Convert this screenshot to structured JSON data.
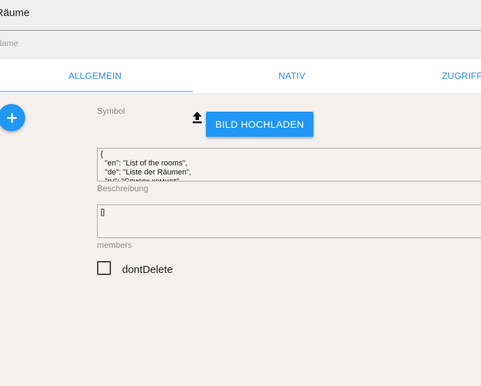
{
  "title_field": {
    "value": "Räume"
  },
  "name_field": {
    "label": "Name"
  },
  "tabs": [
    {
      "label": "ALLGEMEIN",
      "active": true
    },
    {
      "label": "NATIV",
      "active": false
    },
    {
      "label": "ZUGRIFFSRECHTE",
      "active": false
    }
  ],
  "fab": {
    "icon": "plus-icon"
  },
  "symbol": {
    "label": "Symbol",
    "upload_icon": "upload-icon",
    "upload_button": "BILD HOCHLADEN"
  },
  "description": {
    "value": "{\n  \"en\": \"List of the rooms\",\n  \"de\": \"Liste der Räumen\",\n  \"ru\": \"Список комнат\"",
    "label": "Beschreibung"
  },
  "members": {
    "value": "[]",
    "label": "members"
  },
  "dont_delete": {
    "label": "dontDelete",
    "checked": false
  },
  "colors": {
    "accent": "#2196f3",
    "tab_text": "#2e8fe3",
    "background": "#f3f0ed"
  }
}
